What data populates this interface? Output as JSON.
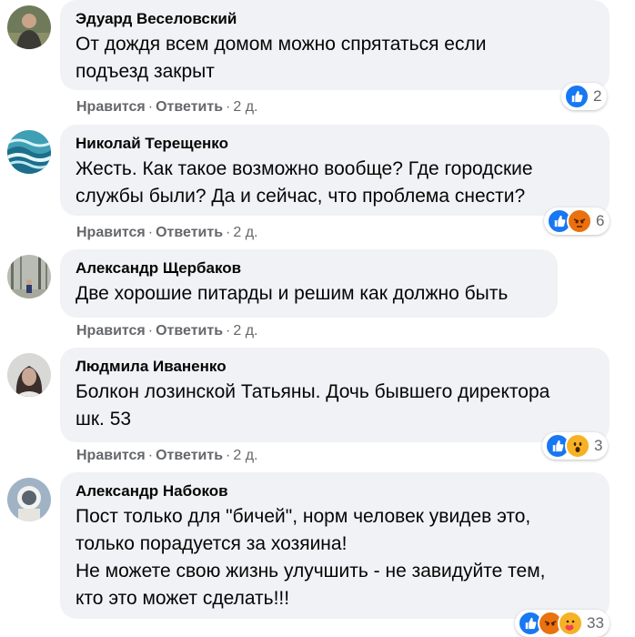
{
  "comments": [
    {
      "author": "Эдуард Веселовский",
      "text": "От дождя всем домом можно спрятаться если\nподъезд закрыт",
      "like_label": "Нравится",
      "reply_label": "Ответить",
      "time": "2 д.",
      "reaction_count": "2",
      "reactions": [
        "like-icon"
      ]
    },
    {
      "author": "Николай Терещенко",
      "text": "Жесть. Как такое возможно вообще? Где городские\nслужбы были? Да и сейчас, что проблема снести?",
      "like_label": "Нравится",
      "reply_label": "Ответить",
      "time": "2 д.",
      "reaction_count": "6",
      "reactions": [
        "like-icon",
        "angry-icon"
      ]
    },
    {
      "author": "Александр Щербаков",
      "text": "Две хорошие питарды и решим как должно быть",
      "like_label": "Нравится",
      "reply_label": "Ответить",
      "time": "2 д."
    },
    {
      "author": "Людмила Иваненко",
      "text": "Болкон лозинской Татьяны. Дочь бывшего директора\nшк. 53",
      "like_label": "Нравится",
      "reply_label": "Ответить",
      "time": "2 д.",
      "reaction_count": "3",
      "reactions": [
        "like-icon",
        "wow-icon"
      ]
    },
    {
      "author": "Александр Набоков",
      "text": "Пост только для \"бичей\", норм человек увидев это,\nтолько порадуется за хозяина!\nНе можете свою жизнь улучшить - не завидуйте тем,\nкто это может сделать!!!",
      "reaction_count": "33",
      "reactions": [
        "like-icon",
        "angry-icon",
        "care-icon"
      ]
    }
  ],
  "colors": {
    "bubble": "#f0f2f5",
    "meta_text": "#65676b",
    "like_blue": "#1877f2",
    "angry_orange": "#e9710f",
    "wow_yellow": "#f7b125"
  }
}
